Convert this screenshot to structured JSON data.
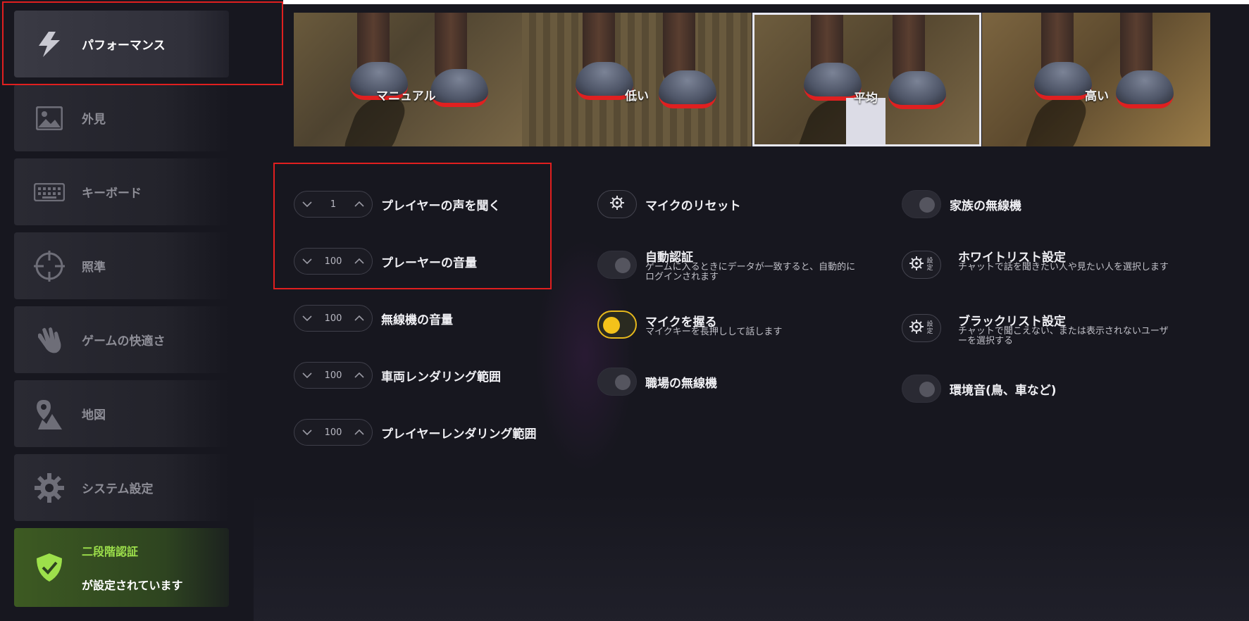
{
  "sidebar": {
    "items": [
      {
        "label": "パフォーマンス",
        "icon": "lightning-icon",
        "active": true
      },
      {
        "label": "外見",
        "icon": "image-icon"
      },
      {
        "label": "キーボード",
        "icon": "keyboard-icon"
      },
      {
        "label": "照準",
        "icon": "crosshair-icon"
      },
      {
        "label": "ゲームの快適さ",
        "icon": "hand-icon"
      },
      {
        "label": "地図",
        "icon": "map-icon"
      },
      {
        "label": "システム設定",
        "icon": "gear-icon"
      }
    ],
    "twofa": {
      "line1": "二段階認証",
      "line2": "が設定されています",
      "icon": "shield-check-icon",
      "color": "#9de04b"
    }
  },
  "presets": [
    {
      "label": "マニュアル",
      "selected": false
    },
    {
      "label": "低い",
      "selected": false
    },
    {
      "label": "平均",
      "selected": true
    },
    {
      "label": "高い",
      "selected": false
    }
  ],
  "steppers": [
    {
      "value": "1",
      "label": "プレイヤーの声を聞く"
    },
    {
      "value": "100",
      "label": "プレーヤーの音量"
    },
    {
      "value": "100",
      "label": "無線機の音量"
    },
    {
      "value": "100",
      "label": "車両レンダリング範囲"
    },
    {
      "value": "100",
      "label": "プレイヤーレンダリング範囲"
    }
  ],
  "middle": {
    "mic_reset": {
      "label": "マイクのリセット"
    },
    "auto_auth": {
      "label": "自動認証",
      "desc": "ゲームに入るときにデータが一致すると、自動的にログインされます",
      "on": false
    },
    "push_to_talk": {
      "label": "マイクを握る",
      "desc": "マイクキーを長押しして話します",
      "on": true
    },
    "job_radio": {
      "label": "職場の無線機",
      "on": false
    }
  },
  "right": {
    "family_radio": {
      "label": "家族の無線機",
      "on": false
    },
    "whitelist": {
      "button": "設定",
      "label": "ホワイトリスト設定",
      "desc": "チャットで話を聞きたい人や見たい人を選択します"
    },
    "blacklist": {
      "button": "設定",
      "label": "ブラックリスト設定",
      "desc": "チャットで聞こえない、または表示されないユーザーを選択する"
    },
    "ambient": {
      "label": "環境音(鳥、車など)",
      "on": false
    }
  },
  "colors": {
    "accent_toggle": "#f3c21a",
    "highlight": "#e01f1f",
    "twofa_green": "#9de04b"
  }
}
